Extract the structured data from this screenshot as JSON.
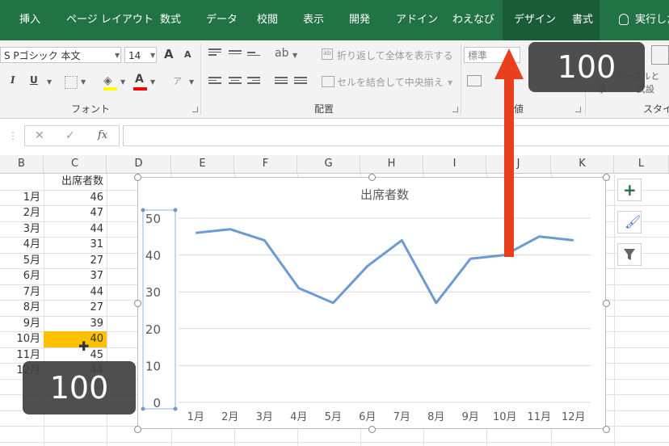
{
  "tabs": [
    "挿入",
    "ページ レイアウト",
    "数式",
    "データ",
    "校閲",
    "表示",
    "開発",
    "アドイン",
    "わえなび",
    "デザイン",
    "書式"
  ],
  "tell_me": "実行した",
  "ribbon": {
    "font_name": "S Pゴシック 本文",
    "font_size": "14",
    "grow_font": "A",
    "shrink_font": "A",
    "underline": "U",
    "italic": "I",
    "wrap_text": "折り返して全体を表示する",
    "merge_center": "セルを結合して中央揃え",
    "number_format": "標準",
    "group_font": "フォント",
    "group_alignment": "配置",
    "group_number": "値",
    "group_styles": "スタイ",
    "table_hint": "テーブルと",
    "cell_style_hint": "式設",
    "to_hint": "示",
    "fill_color": "#ffff00",
    "font_color": "#ff0000"
  },
  "formula_bar": {
    "cancel": "✕",
    "enter": "✓",
    "fx": "fx",
    "value": ""
  },
  "columns": [
    "B",
    "C",
    "D",
    "E",
    "F",
    "G",
    "H",
    "I",
    "J",
    "K",
    "L"
  ],
  "sheet": {
    "header": "出席者数",
    "months": [
      "1月",
      "2月",
      "3月",
      "4月",
      "5月",
      "6月",
      "7月",
      "8月",
      "9月",
      "10月",
      "11月",
      "12月"
    ],
    "values": [
      46,
      47,
      44,
      31,
      27,
      37,
      44,
      27,
      39,
      40,
      45,
      44
    ],
    "selected_index": 9,
    "selected_color": "#ffc000"
  },
  "chart_data": {
    "type": "line",
    "title": "出席者数",
    "categories": [
      "1月",
      "2月",
      "3月",
      "4月",
      "5月",
      "6月",
      "7月",
      "8月",
      "9月",
      "10月",
      "11月",
      "12月"
    ],
    "series": [
      {
        "values": [
          46,
          47,
          44,
          31,
          27,
          37,
          44,
          27,
          39,
          40,
          45,
          44
        ],
        "color": "#6b9bd1"
      }
    ],
    "ylim": [
      0,
      50
    ],
    "yticks": [
      0,
      10,
      20,
      30,
      40,
      50
    ],
    "grid": true
  },
  "overlay": {
    "badge_top": "100",
    "badge_bottom": "100",
    "arrow_color": "#e8401c"
  }
}
